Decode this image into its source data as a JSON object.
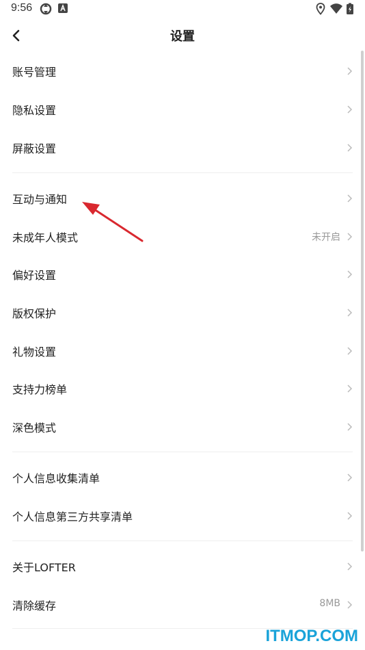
{
  "status_bar": {
    "time": "9:56",
    "left_icons": [
      "sync-icon",
      "app-notification-icon"
    ],
    "right_icons": [
      "location-icon",
      "wifi-icon",
      "battery-icon"
    ]
  },
  "header": {
    "title": "设置",
    "back_icon": "back-arrow-icon"
  },
  "settings": [
    {
      "label": "账号管理",
      "value": ""
    },
    {
      "label": "隐私设置",
      "value": ""
    },
    {
      "label": "屏蔽设置",
      "value": ""
    },
    {
      "label": "互动与通知",
      "value": ""
    },
    {
      "label": "未成年人模式",
      "value": "未开启"
    },
    {
      "label": "偏好设置",
      "value": ""
    },
    {
      "label": "版权保护",
      "value": ""
    },
    {
      "label": "礼物设置",
      "value": ""
    },
    {
      "label": "支持力榜单",
      "value": ""
    },
    {
      "label": "深色模式",
      "value": ""
    },
    {
      "label": "个人信息收集清单",
      "value": ""
    },
    {
      "label": "个人信息第三方共享清单",
      "value": ""
    },
    {
      "label": "关于LOFTER",
      "value": ""
    },
    {
      "label": "清除缓存",
      "value": "8MB"
    }
  ],
  "watermark": "ITMOP.COM",
  "colors": {
    "annotation_arrow": "#d9282f",
    "watermark": "#1aa3d9",
    "secondary_text": "#999999"
  }
}
